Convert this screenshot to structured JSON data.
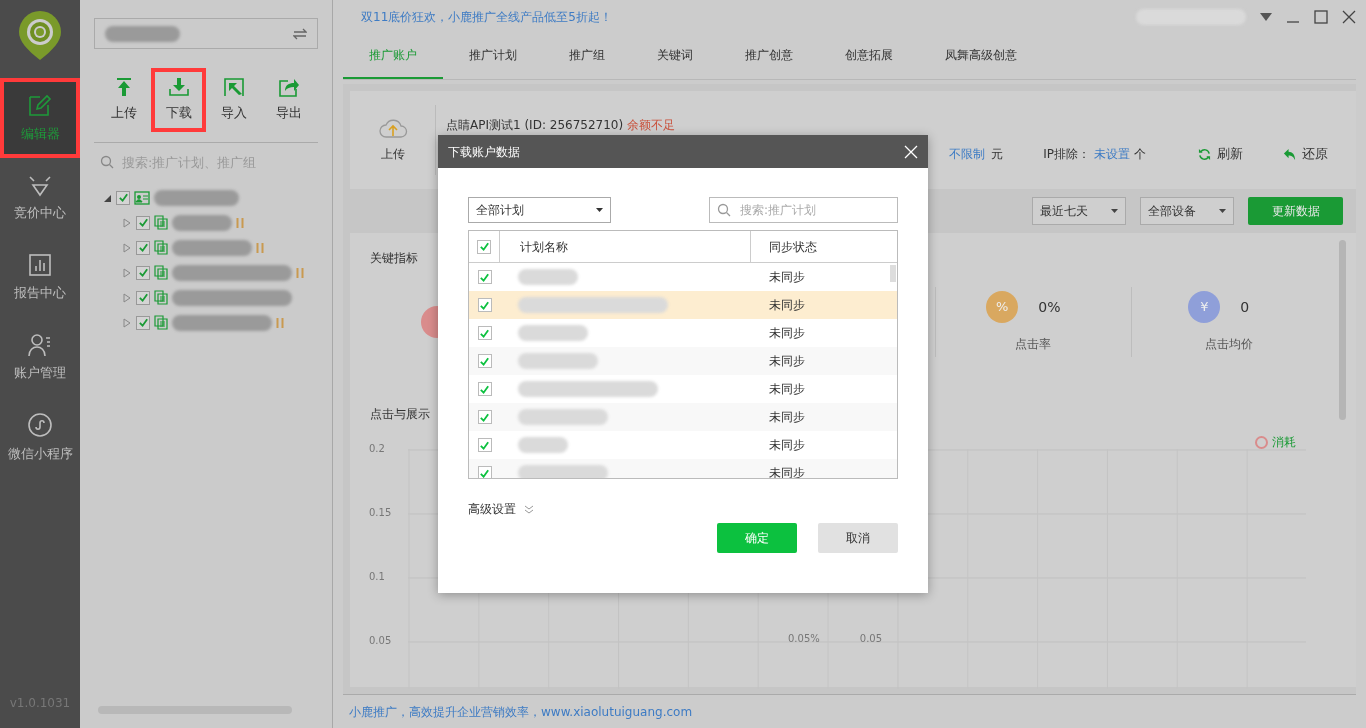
{
  "sidebar": {
    "version": "v1.0.1031",
    "items": [
      {
        "label": "编辑器",
        "selected": true,
        "highlighted": true
      },
      {
        "label": "竞价中心",
        "selected": false,
        "highlighted": false
      },
      {
        "label": "报告中心",
        "selected": false,
        "highlighted": false
      },
      {
        "label": "账户管理",
        "selected": false,
        "highlighted": false
      },
      {
        "label": "微信小程序",
        "selected": false,
        "highlighted": false
      }
    ]
  },
  "left_panel": {
    "toolbar": [
      {
        "label": "上传",
        "highlighted": false
      },
      {
        "label": "下载",
        "highlighted": true
      },
      {
        "label": "导入",
        "highlighted": false
      },
      {
        "label": "导出",
        "highlighted": false
      }
    ],
    "search": {
      "placeholder": "搜索:推广计划、推广组"
    },
    "tree": [
      {
        "checked": true,
        "expanded": true,
        "children": [
          {
            "checked": true,
            "expanded": false,
            "paused": true
          },
          {
            "checked": true,
            "expanded": false,
            "paused": true
          },
          {
            "checked": true,
            "expanded": false,
            "paused": true
          },
          {
            "checked": true,
            "expanded": false,
            "paused": false
          },
          {
            "checked": true,
            "expanded": false,
            "paused": true
          }
        ]
      }
    ]
  },
  "top_bar": {
    "promo": "双11底价狂欢，小鹿推广全线产品低至5折起！"
  },
  "tabs": [
    {
      "label": "推广账户",
      "selected": true
    },
    {
      "label": "推广计划",
      "selected": false
    },
    {
      "label": "推广组",
      "selected": false
    },
    {
      "label": "关键词",
      "selected": false
    },
    {
      "label": "推广创意",
      "selected": false
    },
    {
      "label": "创意拓展",
      "selected": false
    },
    {
      "label": "凤舞高级创意",
      "selected": false
    }
  ],
  "account_card": {
    "upload": "上传",
    "account_name": "点睛API测试1 (ID: 256752710)",
    "balance_warning": "余额不足",
    "budget_value": "不限制",
    "budget_unit": "元",
    "ip_label": "IP排除：",
    "ip_value": "未设置",
    "ip_unit": "个",
    "refresh": "刷新",
    "restore": "还原"
  },
  "filters": {
    "period": "最近七天",
    "device": "全部设备",
    "update_button": "更新数据"
  },
  "metrics": {
    "title": "关键指标",
    "items": [
      {
        "color": "#d98c8c"
      },
      {
        "glyph": "%",
        "value": "0%",
        "label": "点击率",
        "color": "#d9a860"
      },
      {
        "glyph": "¥",
        "value": "0",
        "label": "点击均价",
        "color": "#8f9fd9"
      }
    ]
  },
  "chart_panel": {
    "title": "点击与展示",
    "y_ticks": [
      "0.2",
      "0.15",
      "0.1",
      "0.05"
    ],
    "legend": "消耗",
    "floating_labels": [
      "0.05%",
      "0.05"
    ]
  },
  "footer": "小鹿推广，高效提升企业营销效率，www.xiaolutuiguang.com",
  "dialog": {
    "title": "下载账户数据",
    "plan_select": "全部计划",
    "search": {
      "placeholder": "搜索:推广计划"
    },
    "columns": [
      "计划名称",
      "同步状态"
    ],
    "all_checked": true,
    "rows": [
      {
        "checked": true,
        "selected": false,
        "status": "未同步"
      },
      {
        "checked": true,
        "selected": true,
        "status": "未同步"
      },
      {
        "checked": true,
        "selected": false,
        "status": "未同步"
      },
      {
        "checked": true,
        "selected": false,
        "status": "未同步"
      },
      {
        "checked": true,
        "selected": false,
        "status": "未同步"
      },
      {
        "checked": true,
        "selected": false,
        "status": "未同步"
      },
      {
        "checked": true,
        "selected": false,
        "status": "未同步"
      },
      {
        "checked": true,
        "selected": false,
        "status": "未同步"
      }
    ],
    "advanced": "高级设置",
    "ok": "确定",
    "cancel": "取消"
  }
}
